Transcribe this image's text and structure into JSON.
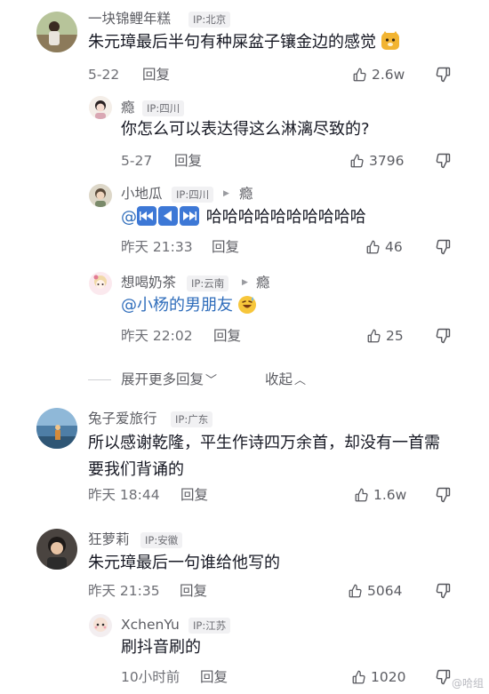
{
  "comments": [
    {
      "user": "一块锦鲤年糕",
      "ip": "IP:北京",
      "text": "朱元璋最后半句有种屎盆子镶金边的感觉",
      "date": "5-22",
      "reply": "回复",
      "likes": "2.6w",
      "avatar_icon": "user-avatar-photo",
      "emoji": "doge-emoji"
    },
    {
      "user": "瘾",
      "ip": "IP:四川",
      "text": "你怎么可以表达得这么淋漓尽致的?",
      "date": "5-27",
      "reply": "回复",
      "likes": "3796"
    },
    {
      "user": "小地瓜",
      "ip": "IP:四川",
      "reply_to": "瘾",
      "mention": "@",
      "text": "哈哈哈哈哈哈哈哈哈哈",
      "date": "昨天 21:33",
      "reply": "回复",
      "likes": "46",
      "media_icons": [
        "rewind-icon",
        "play-back-icon",
        "fast-forward-icon"
      ]
    },
    {
      "user": "想喝奶茶",
      "ip": "IP:云南",
      "reply_to": "瘾",
      "mention": "@小杨的男朋友",
      "date": "昨天 22:02",
      "reply": "回复",
      "likes": "25",
      "emoji": "grinning-sweat-emoji"
    },
    {
      "user": "兔子爱旅行",
      "ip": "IP:广东",
      "text": "所以感谢乾隆，平生作诗四万余首，却没有一首需要我们背诵的",
      "date": "昨天 18:44",
      "reply": "回复",
      "likes": "1.6w"
    },
    {
      "user": "狂萝莉",
      "ip": "IP:安徽",
      "text": "朱元璋最后一句谁给他写的",
      "date": "昨天 21:35",
      "reply": "回复",
      "likes": "5064"
    },
    {
      "user": "XchenYu",
      "ip": "IP:江苏",
      "text": "刷抖音刷的",
      "date": "10小时前",
      "reply": "回复",
      "likes": "1020"
    }
  ],
  "thread_controls": {
    "expand_more": "展开更多回复",
    "collapse": "收起"
  },
  "watermark": "@哈组",
  "colors": {
    "text": "#161823",
    "muted": "#6e6f75",
    "mention": "#2f6dbb",
    "ip_bg": "#f1f1f3"
  }
}
